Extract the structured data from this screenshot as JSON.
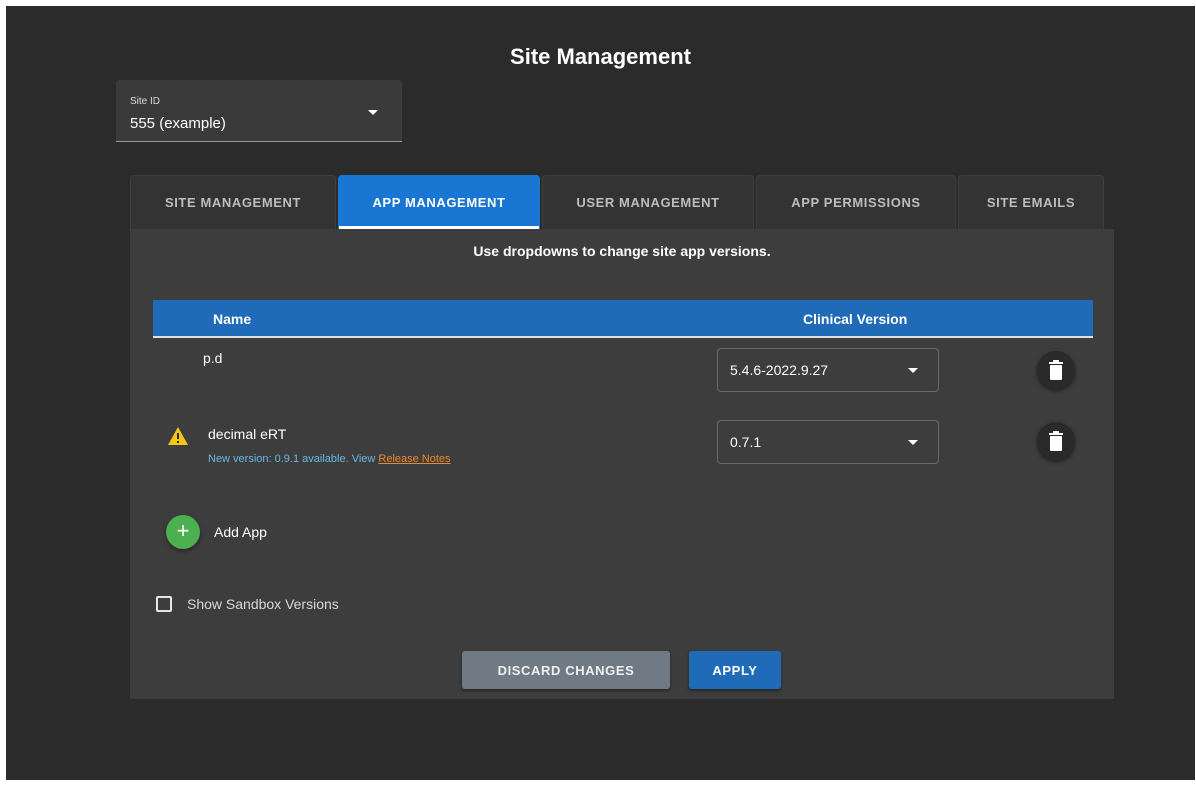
{
  "page_title": "Site Management",
  "site_select": {
    "label": "Site ID",
    "value": "555 (example)"
  },
  "tabs": [
    {
      "label": "SITE MANAGEMENT",
      "active": false
    },
    {
      "label": "APP MANAGEMENT",
      "active": true
    },
    {
      "label": "USER MANAGEMENT",
      "active": false
    },
    {
      "label": "APP PERMISSIONS",
      "active": false
    },
    {
      "label": "SITE EMAILS",
      "active": false
    }
  ],
  "panel": {
    "instructions": "Use dropdowns to change site app versions.",
    "table": {
      "columns": [
        "Name",
        "Clinical Version"
      ],
      "rows": [
        {
          "name": "p.d",
          "version": "5.4.6-2022.9.27",
          "warning": false
        },
        {
          "name": "decimal eRT",
          "version": "0.7.1",
          "warning": true,
          "notice_text": "New version: 0.9.1 available. View ",
          "notice_link": "Release Notes"
        }
      ]
    },
    "add_app_label": "Add App",
    "add_app_icon": "+",
    "sandbox_label": "Show Sandbox Versions",
    "sandbox_checked": false,
    "discard_label": "DISCARD CHANGES",
    "apply_label": "APPLY"
  },
  "colors": {
    "background": "#2b2b2b",
    "panel": "#3d3d3d",
    "accent": "#1f6bb8",
    "warning": "#f5c518",
    "add": "#4caf50",
    "link": "#e98a2f"
  }
}
